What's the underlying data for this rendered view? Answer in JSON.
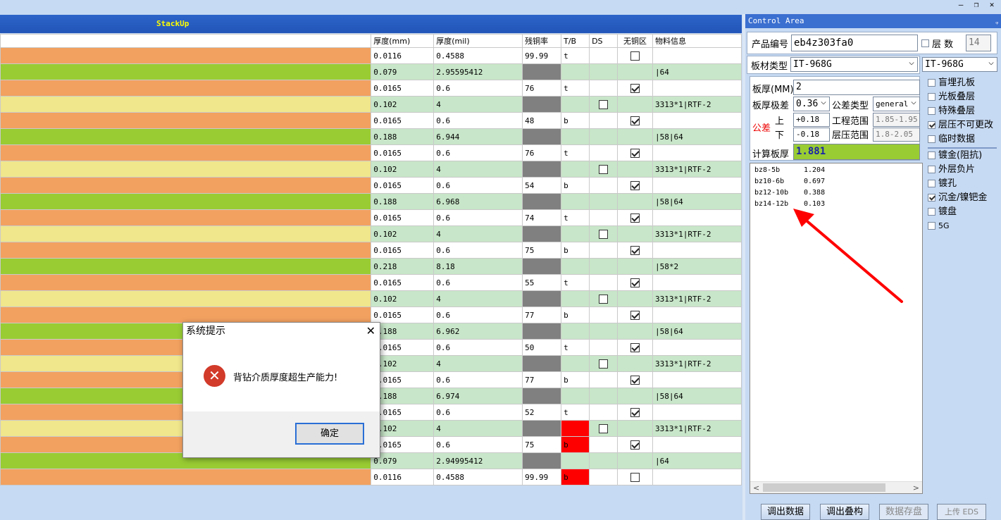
{
  "window": {
    "minimize": "—",
    "restore": "❐",
    "close": "✕"
  },
  "stackup": {
    "title": "StackUp",
    "headers": [
      "厚度(mm)",
      "厚度(mil)",
      "残铜率",
      "T/B",
      "DS",
      "无铜区",
      "物料信息"
    ],
    "rows": [
      {
        "color": "#f2a160",
        "mm": "0.0116",
        "mil": "0.4588",
        "cu": "99.99",
        "tb": "t",
        "ds": "",
        "chk": false,
        "mat": "",
        "rowbg": "#ffffff",
        "cublock": false,
        "red": false
      },
      {
        "color": "#99cc33",
        "mm": "0.079",
        "mil": "2.95595412",
        "cu": "",
        "tb": "",
        "ds": "",
        "chk": null,
        "mat": "|64",
        "rowbg": "#c8e6c9",
        "cublock": true,
        "red": false
      },
      {
        "color": "#f2a160",
        "mm": "0.0165",
        "mil": "0.6",
        "cu": "76",
        "tb": "t",
        "ds": "",
        "chk": true,
        "mat": "",
        "rowbg": "#ffffff",
        "cublock": false,
        "red": false
      },
      {
        "color": "#f0e68c",
        "mm": "0.102",
        "mil": "4",
        "cu": "",
        "tb": "",
        "ds": "chk",
        "chk": null,
        "mat": "3313*1|RTF-2",
        "rowbg": "#c8e6c9",
        "cublock": true,
        "red": false
      },
      {
        "color": "#f2a160",
        "mm": "0.0165",
        "mil": "0.6",
        "cu": "48",
        "tb": "b",
        "ds": "",
        "chk": true,
        "mat": "",
        "rowbg": "#ffffff",
        "cublock": false,
        "red": false
      },
      {
        "color": "#99cc33",
        "mm": "0.188",
        "mil": "6.944",
        "cu": "",
        "tb": "",
        "ds": "",
        "chk": null,
        "mat": "|58|64",
        "rowbg": "#c8e6c9",
        "cublock": true,
        "red": false
      },
      {
        "color": "#f2a160",
        "mm": "0.0165",
        "mil": "0.6",
        "cu": "76",
        "tb": "t",
        "ds": "",
        "chk": true,
        "mat": "",
        "rowbg": "#ffffff",
        "cublock": false,
        "red": false
      },
      {
        "color": "#f0e68c",
        "mm": "0.102",
        "mil": "4",
        "cu": "",
        "tb": "",
        "ds": "chk",
        "chk": null,
        "mat": "3313*1|RTF-2",
        "rowbg": "#c8e6c9",
        "cublock": true,
        "red": false
      },
      {
        "color": "#f2a160",
        "mm": "0.0165",
        "mil": "0.6",
        "cu": "54",
        "tb": "b",
        "ds": "",
        "chk": true,
        "mat": "",
        "rowbg": "#ffffff",
        "cublock": false,
        "red": false
      },
      {
        "color": "#99cc33",
        "mm": "0.188",
        "mil": "6.968",
        "cu": "",
        "tb": "",
        "ds": "",
        "chk": null,
        "mat": "|58|64",
        "rowbg": "#c8e6c9",
        "cublock": true,
        "red": false
      },
      {
        "color": "#f2a160",
        "mm": "0.0165",
        "mil": "0.6",
        "cu": "74",
        "tb": "t",
        "ds": "",
        "chk": true,
        "mat": "",
        "rowbg": "#ffffff",
        "cublock": false,
        "red": false
      },
      {
        "color": "#f0e68c",
        "mm": "0.102",
        "mil": "4",
        "cu": "",
        "tb": "",
        "ds": "chk",
        "chk": null,
        "mat": "3313*1|RTF-2",
        "rowbg": "#c8e6c9",
        "cublock": true,
        "red": false
      },
      {
        "color": "#f2a160",
        "mm": "0.0165",
        "mil": "0.6",
        "cu": "75",
        "tb": "b",
        "ds": "",
        "chk": true,
        "mat": "",
        "rowbg": "#ffffff",
        "cublock": false,
        "red": false
      },
      {
        "color": "#99cc33",
        "mm": "0.218",
        "mil": "8.18",
        "cu": "",
        "tb": "",
        "ds": "",
        "chk": null,
        "mat": "|58*2",
        "rowbg": "#c8e6c9",
        "cublock": true,
        "red": false
      },
      {
        "color": "#f2a160",
        "mm": "0.0165",
        "mil": "0.6",
        "cu": "55",
        "tb": "t",
        "ds": "",
        "chk": true,
        "mat": "",
        "rowbg": "#ffffff",
        "cublock": false,
        "red": false
      },
      {
        "color": "#f0e68c",
        "mm": "0.102",
        "mil": "4",
        "cu": "",
        "tb": "",
        "ds": "chk",
        "chk": null,
        "mat": "3313*1|RTF-2",
        "rowbg": "#c8e6c9",
        "cublock": true,
        "red": false
      },
      {
        "color": "#f2a160",
        "mm": "0.0165",
        "mil": "0.6",
        "cu": "77",
        "tb": "b",
        "ds": "",
        "chk": true,
        "mat": "",
        "rowbg": "#ffffff",
        "cublock": false,
        "red": false
      },
      {
        "color": "#99cc33",
        "mm": "0.188",
        "mil": "6.962",
        "cu": "",
        "tb": "",
        "ds": "",
        "chk": null,
        "mat": "|58|64",
        "rowbg": "#c8e6c9",
        "cublock": true,
        "red": false
      },
      {
        "color": "#f2a160",
        "mm": "0.0165",
        "mil": "0.6",
        "cu": "50",
        "tb": "t",
        "ds": "",
        "chk": true,
        "mat": "",
        "rowbg": "#ffffff",
        "cublock": false,
        "red": false
      },
      {
        "color": "#f0e68c",
        "mm": "0.102",
        "mil": "4",
        "cu": "",
        "tb": "",
        "ds": "chk",
        "chk": null,
        "mat": "3313*1|RTF-2",
        "rowbg": "#c8e6c9",
        "cublock": true,
        "red": false
      },
      {
        "color": "#f2a160",
        "mm": "0.0165",
        "mil": "0.6",
        "cu": "77",
        "tb": "b",
        "ds": "",
        "chk": true,
        "mat": "",
        "rowbg": "#ffffff",
        "cublock": false,
        "red": false
      },
      {
        "color": "#99cc33",
        "mm": "0.188",
        "mil": "6.974",
        "cu": "",
        "tb": "",
        "ds": "",
        "chk": null,
        "mat": "|58|64",
        "rowbg": "#c8e6c9",
        "cublock": true,
        "red": false
      },
      {
        "color": "#f2a160",
        "mm": "0.0165",
        "mil": "0.6",
        "cu": "52",
        "tb": "t",
        "ds": "",
        "chk": true,
        "mat": "",
        "rowbg": "#ffffff",
        "cublock": false,
        "red": false
      },
      {
        "color": "#f0e68c",
        "mm": "0.102",
        "mil": "4",
        "cu": "",
        "tb": "",
        "ds": "chk",
        "chk": null,
        "mat": "3313*1|RTF-2",
        "rowbg": "#c8e6c9",
        "cublock": true,
        "red": true
      },
      {
        "color": "#f2a160",
        "mm": "0.0165",
        "mil": "0.6",
        "cu": "75",
        "tb": "b",
        "ds": "",
        "chk": true,
        "mat": "",
        "rowbg": "#ffffff",
        "cublock": false,
        "red": true
      },
      {
        "color": "#99cc33",
        "mm": "0.079",
        "mil": "2.94995412",
        "cu": "",
        "tb": "",
        "ds": "",
        "chk": null,
        "mat": "|64",
        "rowbg": "#c8e6c9",
        "cublock": true,
        "red": false
      },
      {
        "color": "#f2a160",
        "mm": "0.0116",
        "mil": "0.4588",
        "cu": "99.99",
        "tb": "b",
        "ds": "",
        "chk": false,
        "mat": "",
        "rowbg": "#ffffff",
        "cublock": false,
        "red": true
      }
    ]
  },
  "dialog": {
    "title": "系统提示",
    "close": "✕",
    "icon": "✕",
    "message": "背钻介质厚度超生产能力!",
    "ok": "确定"
  },
  "control": {
    "title": "Control Area",
    "pin": "ᵩ",
    "product_label": "产品编号",
    "product_value": "eb4z303fa0",
    "layer_label": "层 数",
    "layer_value": "14",
    "material_label": "板材类型",
    "material_value": "IT-968G",
    "material_value2": "IT-968G",
    "thickness_label": "板厚(MM)",
    "thickness_value": "2",
    "tol_label": "板厚极差",
    "tol_value": "0.36",
    "tol_type_label": "公差类型",
    "tol_type_value": "general",
    "tol_word": "公差",
    "upper_label": "上",
    "upper_value": "+0.18",
    "lower_label": "下",
    "lower_value": "-0.18",
    "eng_range_label": "工程范围",
    "eng_range_value": "1.85-1.95",
    "press_range_label": "层压范围",
    "press_range_value": "1.8-2.05",
    "calc_label": "计算板厚",
    "calc_value": "1.881",
    "calc_rows": [
      {
        "name": "bz8-5b",
        "value": "1.204"
      },
      {
        "name": "bz10-6b",
        "value": "0.697"
      },
      {
        "name": "bz12-10b",
        "value": "0.388"
      },
      {
        "name": "bz14-12b",
        "value": "0.103"
      }
    ],
    "options_a": [
      {
        "label": "盲埋孔板",
        "on": false
      },
      {
        "label": "光板叠层",
        "on": false
      },
      {
        "label": "特殊叠层",
        "on": false
      },
      {
        "label": "层压不可更改",
        "on": true
      },
      {
        "label": "临时数据",
        "on": false
      }
    ],
    "options_b": [
      {
        "label": "镀金(阻抗)",
        "on": false
      },
      {
        "label": "外层负片",
        "on": false
      },
      {
        "label": "镀孔",
        "on": false
      },
      {
        "label": "沉金/镍钯金",
        "on": true
      },
      {
        "label": "镀盘",
        "on": false
      },
      {
        "label": "5G",
        "on": false
      }
    ],
    "buttons": [
      {
        "label": "调出数据",
        "enabled": true
      },
      {
        "label": "调出叠构",
        "enabled": true
      },
      {
        "label": "数据存盘",
        "enabled": false
      },
      {
        "label": "上传 EDS",
        "enabled": false
      }
    ],
    "scroll_left": "<",
    "scroll_right": ">"
  }
}
